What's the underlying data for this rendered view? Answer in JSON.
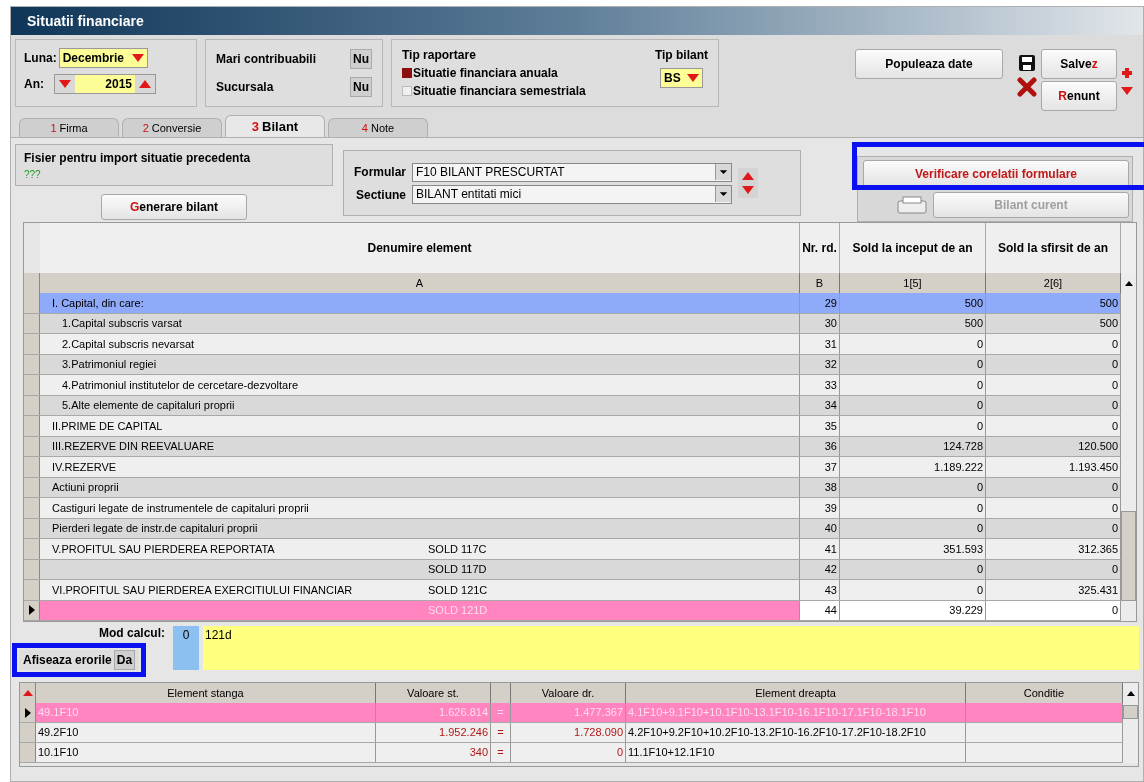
{
  "window": {
    "title": "Situatii financiare"
  },
  "period": {
    "month_label": "Luna:",
    "month": "Decembrie",
    "year_label": "An:",
    "year": "2015"
  },
  "flags": [
    {
      "label": "Mari contribuabili",
      "value": "Nu"
    },
    {
      "label": "Sucursala",
      "value": "Nu"
    }
  ],
  "report_type": {
    "title": "Tip raportare",
    "options": [
      {
        "label": "Situatie financiara anuala",
        "checked": true
      },
      {
        "label": "Situatie financiara semestriala",
        "checked": false
      }
    ]
  },
  "balance_type": {
    "label": "Tip bilant",
    "value": "BS"
  },
  "populate_button": "Populeaza date",
  "save_button": [
    {
      "text": "Salve",
      "accent": false
    },
    {
      "text": "z",
      "accent": true
    }
  ],
  "cancel_button": [
    {
      "text": "R",
      "accent": true
    },
    {
      "text": "enunt",
      "accent": false
    }
  ],
  "tabs": [
    {
      "number": "1",
      "label": "Firma",
      "selected": false
    },
    {
      "number": "2",
      "label": "Conversie",
      "selected": false
    },
    {
      "number": "3",
      "label": "Bilant",
      "selected": true
    },
    {
      "number": "4",
      "label": "Note",
      "selected": false
    }
  ],
  "import": {
    "label": "Fisier pentru import situatie precedenta",
    "value": "???"
  },
  "generate_button": [
    {
      "text": "G",
      "accent": true
    },
    {
      "text": "enerare bilant",
      "accent": false
    }
  ],
  "form": {
    "formular_label": "Formular",
    "formular": "F10 BILANT PRESCURTAT",
    "section_label": "Sectiune",
    "section": "BILANT entitati mici"
  },
  "check_button": "Verificare corelatii formulare",
  "current_button": {
    "label": "Bilant curent",
    "disabled": true
  },
  "table": {
    "columns": [
      "Denumire element",
      "Nr. rd.",
      "Sold la inceput de an",
      "Sold la sfirsit de an"
    ],
    "codes": [
      "A",
      "B",
      "1[5]",
      "2[6]"
    ],
    "rows": [
      {
        "name": "I. Capital, din care:",
        "nr": "29",
        "start": "500",
        "end": "500",
        "selected": true,
        "error": false,
        "children": [
          {
            "name": "1.Capital subscris varsat",
            "nr": "30",
            "start": "500",
            "end": "500",
            "selected": false,
            "error": false
          },
          {
            "name": "2.Capital subscris nevarsat",
            "nr": "31",
            "start": "0",
            "end": "0",
            "selected": false,
            "error": false
          },
          {
            "name": "3.Patrimoniul regiei",
            "nr": "32",
            "start": "0",
            "end": "0",
            "selected": false,
            "error": false
          },
          {
            "name": "4.Patrimoniul institutelor de cercetare-dezvoltare",
            "nr": "33",
            "start": "0",
            "end": "0",
            "selected": false,
            "error": false
          },
          {
            "name": "5.Alte elemente de capitaluri proprii",
            "nr": "34",
            "start": "0",
            "end": "0",
            "selected": false,
            "error": false
          }
        ]
      },
      {
        "name": "II.PRIME DE CAPITAL",
        "nr": "35",
        "start": "0",
        "end": "0",
        "selected": false,
        "error": false
      },
      {
        "name": "III.REZERVE DIN REEVALUARE",
        "nr": "36",
        "start": "124.728",
        "end": "120.500",
        "selected": false,
        "error": false
      },
      {
        "name": "IV.REZERVE",
        "nr": "37",
        "start": "1.189.222",
        "end": "1.193.450",
        "selected": false,
        "error": false
      },
      {
        "name": "Actiuni proprii",
        "nr": "38",
        "start": "0",
        "end": "0",
        "selected": false,
        "error": false
      },
      {
        "name": "Castiguri legate de instrumentele de capitaluri proprii",
        "nr": "39",
        "start": "0",
        "end": "0",
        "selected": false,
        "error": false
      },
      {
        "name": "Pierderi legate de instr.de capitaluri proprii",
        "nr": "40",
        "start": "0",
        "end": "0",
        "selected": false,
        "error": false
      },
      {
        "name": "V.PROFITUL SAU PIERDEREA REPORTATA",
        "account": "SOLD 117C",
        "nr": "41",
        "start": "351.593",
        "end": "312.365",
        "selected": false,
        "error": false
      },
      {
        "account": "SOLD 117D",
        "nr": "42",
        "start": "0",
        "end": "0",
        "selected": false,
        "error": false
      },
      {
        "name": "VI.PROFITUL SAU PIERDEREA EXERCITIULUI FINANCIAR",
        "account": "SOLD 121C",
        "nr": "43",
        "start": "0",
        "end": "325.431",
        "selected": false,
        "error": false
      },
      {
        "account": "SOLD 121D",
        "nr": "44",
        "start": "39.229",
        "end": "0",
        "selected": false,
        "error": true
      }
    ]
  },
  "calc": {
    "label": "Mod calcul:",
    "mode": "0",
    "formula": "121d"
  },
  "show_errors": {
    "label": "Afiseaza erorile",
    "value": "Da"
  },
  "errors": {
    "columns": [
      "Element stanga",
      "Valoare st.",
      "",
      "Valoare dr.",
      "Element dreapta",
      "Conditie"
    ],
    "rows": [
      {
        "left": "49.1F10",
        "left_value": "1.626.814",
        "op": "=",
        "right_value": "1.477.367",
        "right": "4.1F10+9.1F10+10.1F10-13.1F10-16.1F10-17.1F10-18.1F10",
        "selected": true
      },
      {
        "left": "49.2F10",
        "left_value": "1.952.246",
        "op": "=",
        "right_value": "1.728.090",
        "right": "4.2F10+9.2F10+10.2F10-13.2F10-16.2F10-17.2F10-18.2F10",
        "selected": false
      },
      {
        "left": "10.1F10",
        "left_value": "340",
        "op": "=",
        "right_value": "0",
        "right": "11.1F10+12.1F10",
        "selected": false
      }
    ]
  }
}
